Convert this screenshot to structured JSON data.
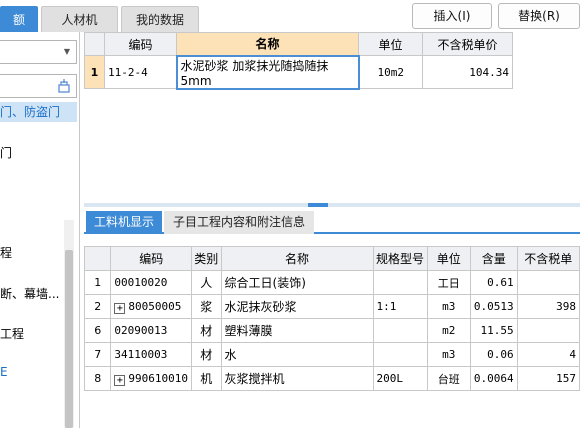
{
  "tabs": [
    {
      "label": "额"
    },
    {
      "label": "人材机"
    },
    {
      "label": "我的数据"
    }
  ],
  "buttons": {
    "insert": "插入(I)",
    "replace": "替换(R)"
  },
  "left_panel": {
    "dropdown_value": "",
    "search_placeholder": "",
    "items": [
      {
        "label": "门、防盗门"
      },
      {
        "label": "门"
      },
      {
        "label": "程"
      },
      {
        "label": "断、幕墙..."
      },
      {
        "label": "工程"
      },
      {
        "label": "E"
      }
    ]
  },
  "upper_grid": {
    "headers": [
      "编码",
      "名称",
      "单位",
      "不含税单价"
    ],
    "rows": [
      {
        "num": "1",
        "code": "11-2-4",
        "name": "水泥砂浆 加浆抹光随捣随抹5mm",
        "unit": "10m2",
        "price": "104.34"
      }
    ]
  },
  "lower_tabs": [
    {
      "label": "工料机显示"
    },
    {
      "label": "子目工程内容和附注信息"
    }
  ],
  "lower_grid": {
    "headers": [
      "",
      "编码",
      "类别",
      "名称",
      "规格型号",
      "单位",
      "含量",
      "不含税单"
    ],
    "rows": [
      {
        "num": "1",
        "plus": false,
        "code": "00010020",
        "type": "人",
        "name": "综合工日(装饰)",
        "spec": "",
        "unit": "工日",
        "qty": "0.61",
        "price": ""
      },
      {
        "num": "2",
        "plus": true,
        "code": "80050005",
        "type": "浆",
        "name": "水泥抹灰砂浆",
        "spec": "1:1",
        "unit": "m3",
        "qty": "0.0513",
        "price": "398"
      },
      {
        "num": "6",
        "plus": false,
        "code": "02090013",
        "type": "材",
        "name": "塑料薄膜",
        "spec": "",
        "unit": "m2",
        "qty": "11.55",
        "price": ""
      },
      {
        "num": "7",
        "plus": false,
        "code": "34110003",
        "type": "材",
        "name": "水",
        "spec": "",
        "unit": "m3",
        "qty": "0.06",
        "price": "4"
      },
      {
        "num": "8",
        "plus": true,
        "code": "990610010",
        "type": "机",
        "name": "灰浆搅拌机",
        "spec": "200L",
        "unit": "台班",
        "qty": "0.0064",
        "price": "157"
      }
    ]
  },
  "colors": {
    "accent": "#3d8ad6",
    "highlight": "#fde2b8",
    "selected_bg": "#cfe3f7"
  }
}
